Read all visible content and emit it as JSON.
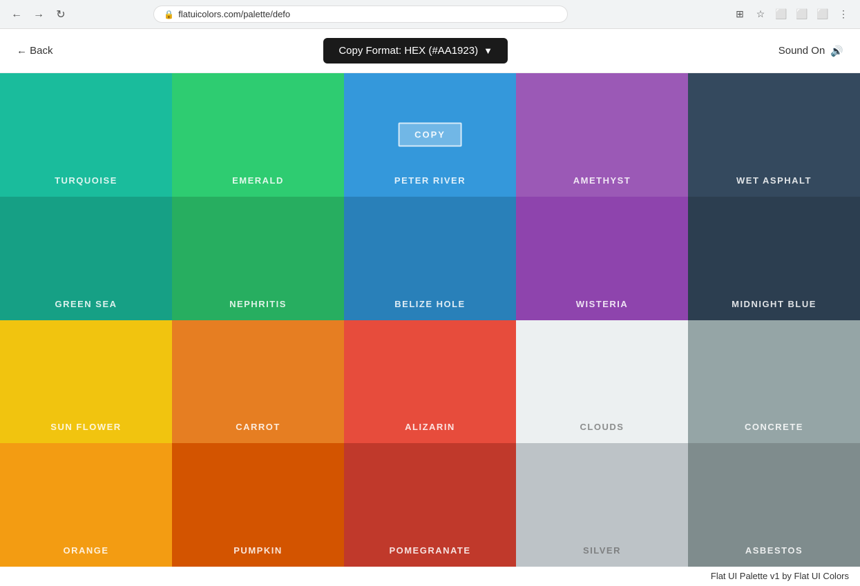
{
  "browser": {
    "url": "flatuicolors.com/palette/defo",
    "back_label": "←",
    "forward_label": "→",
    "reload_label": "↻"
  },
  "header": {
    "back_label": "← Back",
    "copy_format_label": "Copy Format: HEX (#AA1923)",
    "copy_format_dropdown": "▼",
    "sound_label": "Sound On",
    "sound_icon": "🔊"
  },
  "footer": {
    "credit": "Flat UI Palette v1 by Flat UI Colors"
  },
  "colors": [
    {
      "id": "turquoise",
      "name": "TURQUOISE",
      "hex": "#1ABC9C",
      "dark": false
    },
    {
      "id": "emerald",
      "name": "EMERALD",
      "hex": "#2ECC71",
      "dark": false
    },
    {
      "id": "peter-river",
      "name": "PETER RIVER",
      "hex": "#3498DB",
      "dark": false,
      "show_copy": true
    },
    {
      "id": "amethyst",
      "name": "AMETHYST",
      "hex": "#9B59B6",
      "dark": false
    },
    {
      "id": "wet-asphalt",
      "name": "WET ASPHALT",
      "hex": "#34495E",
      "dark": false
    },
    {
      "id": "green-sea",
      "name": "GREEN SEA",
      "hex": "#16A085",
      "dark": false
    },
    {
      "id": "nephritis",
      "name": "NEPHRITIS",
      "hex": "#27AE60",
      "dark": false
    },
    {
      "id": "belize-hole",
      "name": "BELIZE HOLE",
      "hex": "#2980B9",
      "dark": false
    },
    {
      "id": "wisteria",
      "name": "WISTERIA",
      "hex": "#8E44AD",
      "dark": false
    },
    {
      "id": "midnight-blue",
      "name": "MIDNIGHT BLUE",
      "hex": "#2C3E50",
      "dark": false
    },
    {
      "id": "sun-flower",
      "name": "SUN FLOWER",
      "hex": "#F1C40F",
      "dark": false
    },
    {
      "id": "carrot",
      "name": "CARROT",
      "hex": "#E67E22",
      "dark": false
    },
    {
      "id": "alizarin",
      "name": "ALIZARIN",
      "hex": "#E74C3C",
      "dark": false
    },
    {
      "id": "clouds",
      "name": "CLOUDS",
      "hex": "#ECF0F1",
      "dark": true
    },
    {
      "id": "concrete",
      "name": "CONCRETE",
      "hex": "#95A5A6",
      "dark": false
    },
    {
      "id": "orange",
      "name": "ORANGE",
      "hex": "#F39C12",
      "dark": false
    },
    {
      "id": "pumpkin",
      "name": "PUMPKIN",
      "hex": "#D35400",
      "dark": false
    },
    {
      "id": "pomegranate",
      "name": "POMEGRANATE",
      "hex": "#C0392B",
      "dark": false
    },
    {
      "id": "silver",
      "name": "SILVER",
      "hex": "#BDC3C7",
      "dark": true
    },
    {
      "id": "asbestos",
      "name": "ASBESTOS",
      "hex": "#7F8C8D",
      "dark": false
    }
  ],
  "copy_label": "COPY"
}
